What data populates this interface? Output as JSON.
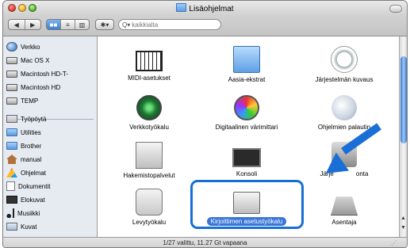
{
  "window": {
    "title": "Lisäohjelmat"
  },
  "toolbar": {
    "back_label": "◀",
    "forward_label": "▶",
    "view_icon": "■■",
    "view_list": "≡",
    "view_column": "▥",
    "action_label": "✱▾",
    "search_placeholder": "kaikkialta",
    "search_scope_icon": "Q▾"
  },
  "sidebar": {
    "devices": [
      {
        "label": "Verkko",
        "icon": "network-globe-icon"
      },
      {
        "label": "Mac OS X",
        "icon": "hard-disk-icon"
      },
      {
        "label": "Macintosh HD-T-",
        "icon": "hard-disk-icon"
      },
      {
        "label": "Macintosh HD",
        "icon": "hard-disk-icon"
      },
      {
        "label": "TEMP",
        "icon": "hard-disk-icon"
      }
    ],
    "places": [
      {
        "label": "Työpöytä",
        "icon": "desktop-icon"
      },
      {
        "label": "Utilities",
        "icon": "folder-icon"
      },
      {
        "label": "Brother",
        "icon": "folder-icon"
      },
      {
        "label": "manual",
        "icon": "home-icon"
      },
      {
        "label": "Ohjelmat",
        "icon": "applications-icon"
      },
      {
        "label": "Dokumentit",
        "icon": "document-icon"
      },
      {
        "label": "Elokuvat",
        "icon": "film-icon"
      },
      {
        "label": "Musiikki",
        "icon": "music-icon"
      },
      {
        "label": "Kuvat",
        "icon": "pictures-icon"
      }
    ]
  },
  "apps": [
    {
      "label": "MIDI-asetukset",
      "icon": "midi-keyboard-icon"
    },
    {
      "label": "Aasia-ekstrat",
      "icon": "folder-icon"
    },
    {
      "label": "Järjestelmän kuvaus",
      "icon": "system-profiler-icon"
    },
    {
      "label": "Verkkotyökalu",
      "icon": "network-utility-icon"
    },
    {
      "label": "Digitaalinen värimittari",
      "icon": "color-meter-icon"
    },
    {
      "label": "Ohjelmien palautin",
      "icon": "migration-icon"
    },
    {
      "label": "Hakemistopalvelut",
      "icon": "directory-services-icon"
    },
    {
      "label": "Konsoli",
      "icon": "console-icon"
    },
    {
      "label": "Järjestelmän...",
      "label_visible_prefix": "Järje",
      "label_visible_suffix": "onta",
      "icon": "keychain-icon"
    },
    {
      "label": "Levytyökalu",
      "icon": "disk-utility-icon"
    },
    {
      "label": "Kirjoittimen asetustyökalu",
      "icon": "printer-icon",
      "selected": true
    },
    {
      "label": "Asentaja",
      "icon": "installer-icon"
    }
  ],
  "status": {
    "text": "1/27 valittu, 11.27 Gt vapaana"
  },
  "colors": {
    "accent": "#1670d4",
    "selection": "#3875d7"
  }
}
